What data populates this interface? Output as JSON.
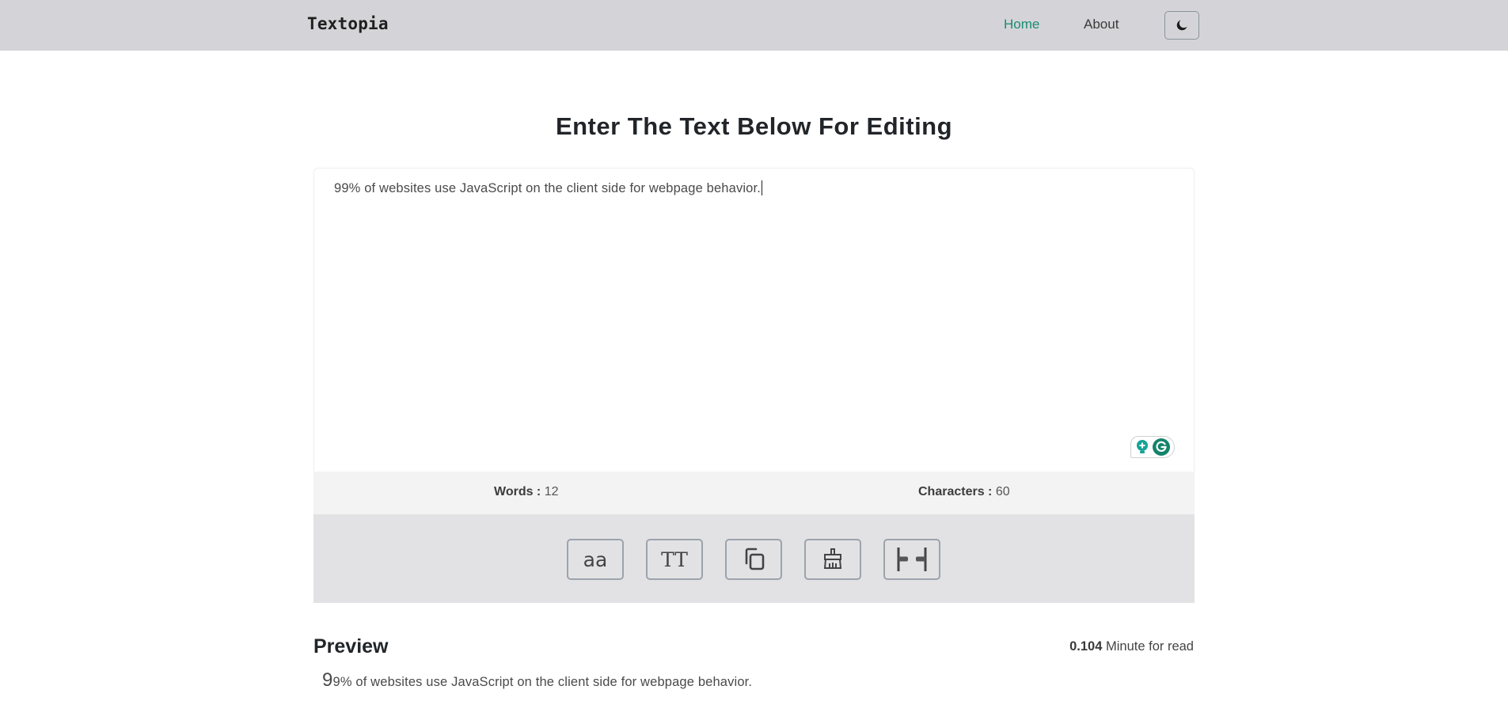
{
  "navbar": {
    "brand": "Textopia",
    "links": [
      {
        "label": "Home",
        "active": true
      },
      {
        "label": "About",
        "active": false
      }
    ],
    "theme_toggle_icon": "moon-icon"
  },
  "main": {
    "title": "Enter The Text Below For Editing",
    "editor": {
      "value": "99% of websites use JavaScript on the client side for webpage behavior.",
      "extension_icons": [
        "lightbulb-icon",
        "grammarly-icon"
      ]
    },
    "stats": {
      "words_label": "Words :",
      "words_value": "12",
      "characters_label": "Characters :",
      "characters_value": "60"
    },
    "toolbar": {
      "buttons": [
        {
          "label": "aa",
          "action": "lowercase",
          "icon": "lowercase-icon"
        },
        {
          "label": "TT",
          "action": "uppercase",
          "icon": "uppercase-icon"
        },
        {
          "label": "",
          "action": "copy",
          "icon": "copy-icon"
        },
        {
          "label": "",
          "action": "clear",
          "icon": "broom-icon"
        },
        {
          "label": "",
          "action": "remove-extra-spaces",
          "icon": "collapse-spaces-icon"
        }
      ]
    },
    "preview": {
      "title": "Preview",
      "read_time_value": "0.104",
      "read_time_label": "Minute for read",
      "first_letter": "9",
      "rest_text": "9% of websites use JavaScript on the client side for webpage behavior."
    }
  },
  "colors": {
    "navbar_bg": "#d4d4d8",
    "accent": "#198c74",
    "stats_bg": "#f3f3f3",
    "toolbar_bg": "#e2e2e4",
    "grammarly": "#15836b"
  }
}
